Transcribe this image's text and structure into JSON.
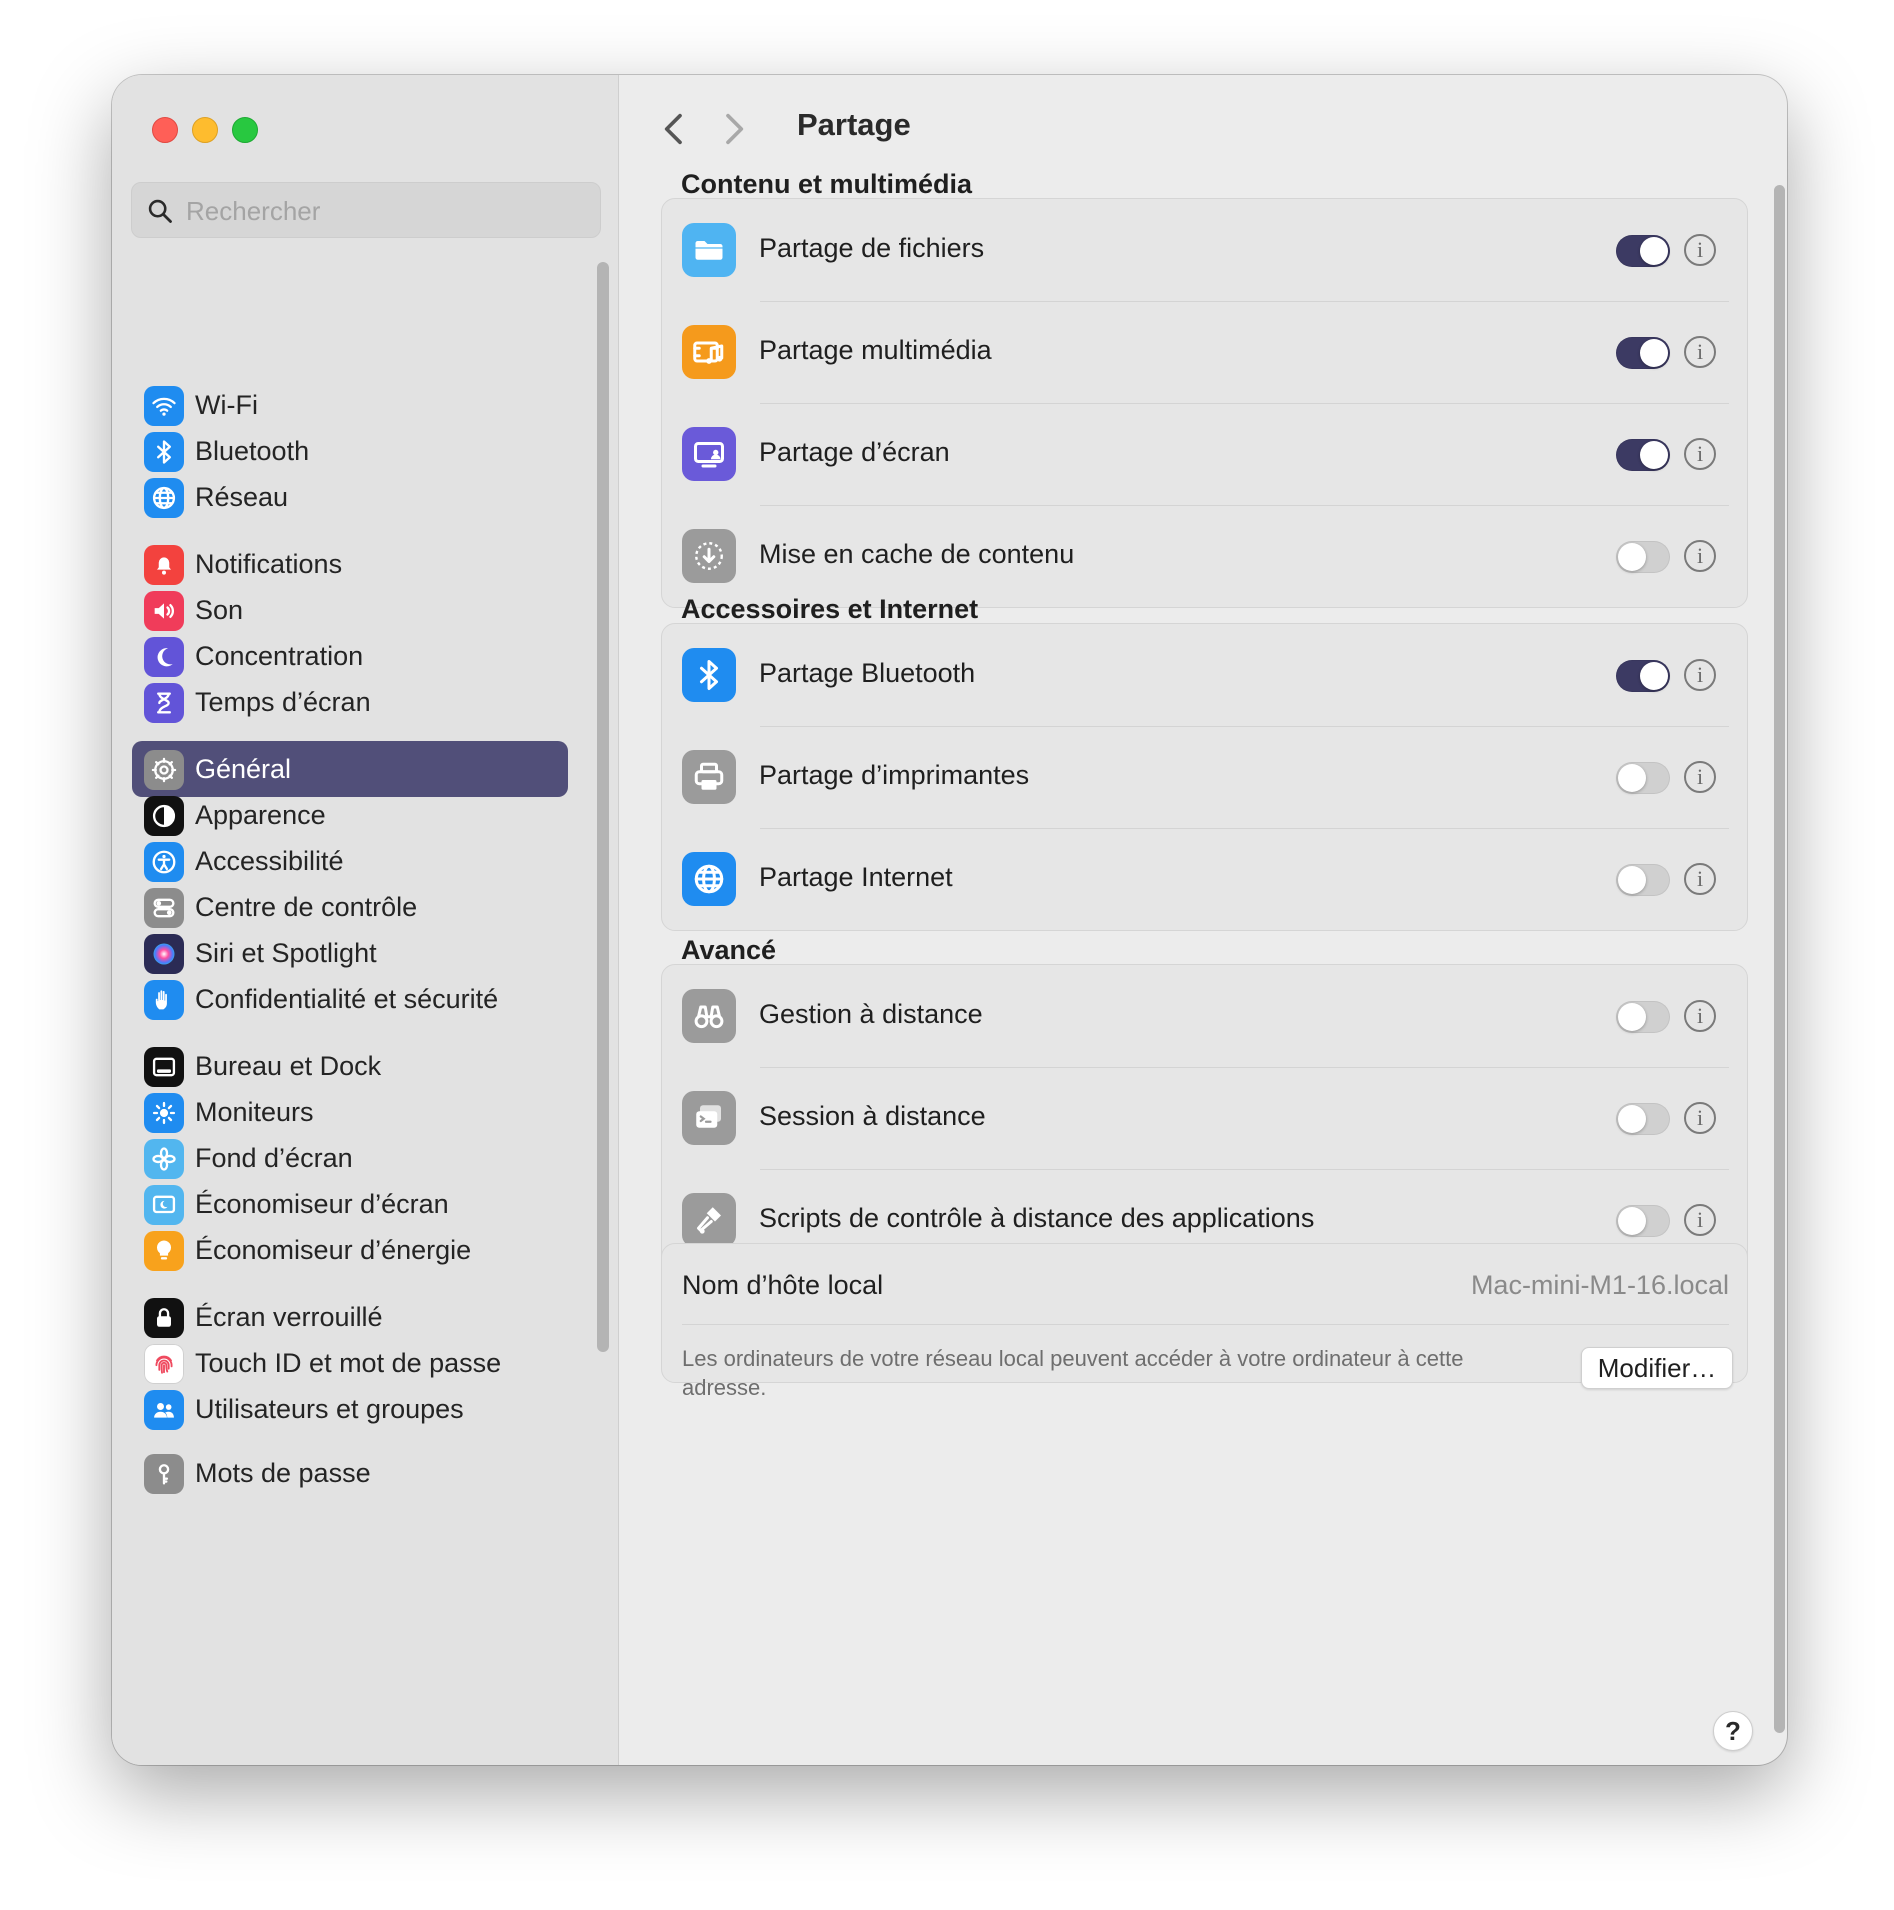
{
  "search": {
    "placeholder": "Rechercher"
  },
  "sidebar": {
    "items": [
      {
        "label": "Wi-Fi",
        "name": "wifi",
        "icon": "wifi-icon",
        "color": "#1f8cf0"
      },
      {
        "label": "Bluetooth",
        "name": "bluetooth",
        "icon": "bluetooth-icon",
        "color": "#1f8cf0"
      },
      {
        "label": "Réseau",
        "name": "reseau",
        "icon": "globe-icon",
        "color": "#1f8cf0"
      },
      {
        "label": "Notifications",
        "name": "notifications",
        "icon": "bell-icon",
        "color": "#f3423e"
      },
      {
        "label": "Son",
        "name": "son",
        "icon": "speaker-icon",
        "color": "#f03c5a"
      },
      {
        "label": "Concentration",
        "name": "concentration",
        "icon": "moon-icon",
        "color": "#6254d8"
      },
      {
        "label": "Temps d’écran",
        "name": "temps-ecran",
        "icon": "hourglass-icon",
        "color": "#6254d8"
      },
      {
        "label": "Général",
        "name": "general",
        "icon": "gear-icon",
        "color": "#8c8c8c",
        "selected": true
      },
      {
        "label": "Apparence",
        "name": "apparence",
        "icon": "appearance-icon",
        "color": "#111111"
      },
      {
        "label": "Accessibilité",
        "name": "accessibilite",
        "icon": "accessibility-icon",
        "color": "#1f8cf0"
      },
      {
        "label": "Centre de contrôle",
        "name": "centre-controle",
        "icon": "switches-icon",
        "color": "#8c8c8c"
      },
      {
        "label": "Siri et Spotlight",
        "name": "siri-spotlight",
        "icon": "siri-icon",
        "color": "#2b2b55"
      },
      {
        "label": "Confidentialité et sécurité",
        "name": "confidentialite",
        "icon": "hand-icon",
        "color": "#1f8cf0"
      },
      {
        "label": "Bureau et Dock",
        "name": "bureau-dock",
        "icon": "dock-icon",
        "color": "#111111"
      },
      {
        "label": "Moniteurs",
        "name": "moniteurs",
        "icon": "sun-icon",
        "color": "#1f8cf0"
      },
      {
        "label": "Fond d’écran",
        "name": "fond-ecran",
        "icon": "flower-icon",
        "color": "#52b6ef"
      },
      {
        "label": "Économiseur d’écran",
        "name": "economiseur-ecran",
        "icon": "screensaver-icon",
        "color": "#52b6ef"
      },
      {
        "label": "Économiseur d’énergie",
        "name": "economiseur-energie",
        "icon": "bulb-icon",
        "color": "#f8a21c"
      },
      {
        "label": "Écran verrouillé",
        "name": "ecran-verrouille",
        "icon": "lock-icon",
        "color": "#111111"
      },
      {
        "label": "Touch ID et mot de passe",
        "name": "touch-id",
        "icon": "fingerprint-icon",
        "color": "#ffffff"
      },
      {
        "label": "Utilisateurs et groupes",
        "name": "utilisateurs",
        "icon": "users-icon",
        "color": "#1f8cf0"
      },
      {
        "label": "Mots de passe",
        "name": "mots-de-passe",
        "icon": "key-icon",
        "color": "#8c8c8c"
      }
    ]
  },
  "header": {
    "title": "Partage",
    "back": "chevron-left-icon",
    "forward": "chevron-right-icon"
  },
  "sections": [
    {
      "title": "Contenu et multimédia",
      "rows": [
        {
          "label": "Partage de fichiers",
          "name": "partage-fichiers",
          "icon": "folder-icon",
          "color": "#4fb4f2",
          "on": true
        },
        {
          "label": "Partage multimédia",
          "name": "partage-multimedia",
          "icon": "music-film-icon",
          "color": "#f59a1c",
          "on": true
        },
        {
          "label": "Partage d’écran",
          "name": "partage-ecran",
          "icon": "screen-share-icon",
          "color": "#6a5ad9",
          "on": true
        },
        {
          "label": "Mise en cache de contenu",
          "name": "cache-contenu",
          "icon": "download-circle-icon",
          "color": "#9b9b9b",
          "on": false
        }
      ]
    },
    {
      "title": "Accessoires et Internet",
      "rows": [
        {
          "label": "Partage Bluetooth",
          "name": "partage-bluetooth",
          "icon": "bluetooth-icon",
          "color": "#1f8cf0",
          "on": true
        },
        {
          "label": "Partage d’imprimantes",
          "name": "partage-imprimantes",
          "icon": "printer-icon",
          "color": "#9b9b9b",
          "on": false
        },
        {
          "label": "Partage Internet",
          "name": "partage-internet",
          "icon": "globe-icon",
          "color": "#1f8cf0",
          "on": false
        }
      ]
    },
    {
      "title": "Avancé",
      "rows": [
        {
          "label": "Gestion à distance",
          "name": "gestion-distance",
          "icon": "binoculars-icon",
          "color": "#9b9b9b",
          "on": false
        },
        {
          "label": "Session à distance",
          "name": "session-distance",
          "icon": "terminal-icon",
          "color": "#9b9b9b",
          "on": false
        },
        {
          "label": "Scripts de contrôle à distance des applications",
          "name": "scripts-controle",
          "icon": "script-icon",
          "color": "#9b9b9b",
          "on": false
        }
      ]
    }
  ],
  "host": {
    "title": "Nom d’hôte local",
    "value": "Mac-mini-M1-16.local",
    "description": "Les ordinateurs de votre réseau local peuvent accéder à votre ordinateur à cette adresse.",
    "button": "Modifier…"
  },
  "help": {
    "label": "?"
  },
  "colors": {
    "accent": "#3c3a63",
    "selection": "#514f79"
  }
}
